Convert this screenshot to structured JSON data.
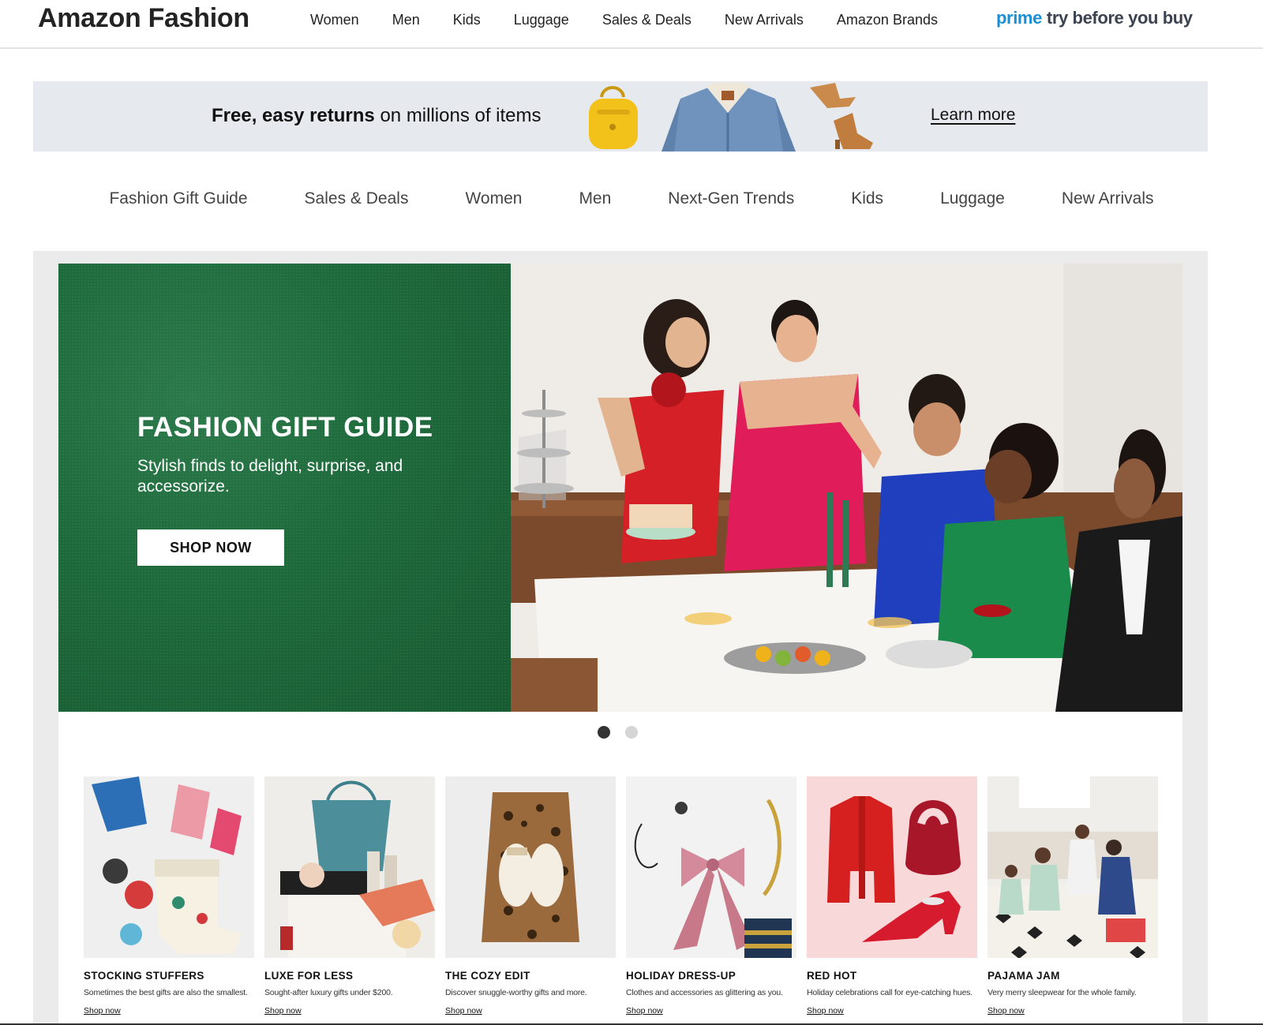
{
  "header": {
    "brand": "Amazon Fashion",
    "nav": [
      "Women",
      "Men",
      "Kids",
      "Luggage",
      "Sales & Deals",
      "New Arrivals",
      "Amazon Brands"
    ],
    "prime_word": "prime",
    "prime_tagline": "try before you buy"
  },
  "returns_banner": {
    "bold_text": "Free, easy returns",
    "text": " on millions of items",
    "link": "Learn more",
    "images": [
      "yellow-backpack",
      "denim-jacket",
      "tan-boots"
    ]
  },
  "category_nav": [
    "Fashion Gift Guide",
    "Sales & Deals",
    "Women",
    "Men",
    "Next-Gen Trends",
    "Kids",
    "Luggage",
    "New Arrivals"
  ],
  "hero": {
    "title": "FASHION GIFT GUIDE",
    "subtitle": "Stylish finds to delight, surprise, and accessorize.",
    "button": "SHOP NOW",
    "photo": "holiday-dinner-party",
    "background_color": "#1e6a3c",
    "slides": 2,
    "active_slide": 1
  },
  "tiles": [
    {
      "title": "STOCKING STUFFERS",
      "desc": "Sometimes the best gifts are also the smallest.",
      "link": "Shop now",
      "image": "stocking-and-small-gifts"
    },
    {
      "title": "LUXE FOR LESS",
      "desc": "Sought-after luxury gifts under $200.",
      "link": "Shop now",
      "image": "basket-bag-and-beauty"
    },
    {
      "title": "THE COZY EDIT",
      "desc": "Discover snuggle-worthy gifts and more.",
      "link": "Shop now",
      "image": "leopard-robe-and-slippers"
    },
    {
      "title": "HOLIDAY DRESS-UP",
      "desc": "Clothes and accessories as glittering as you.",
      "link": "Shop now",
      "image": "bow-and-jewelry"
    },
    {
      "title": "RED HOT",
      "desc": "Holiday celebrations call for eye-catching hues.",
      "link": "Shop now",
      "image": "red-jacket-bag-heels"
    },
    {
      "title": "PAJAMA JAM",
      "desc": "Very merry sleepwear for the whole family.",
      "link": "Shop now",
      "image": "family-in-pajamas"
    }
  ]
}
